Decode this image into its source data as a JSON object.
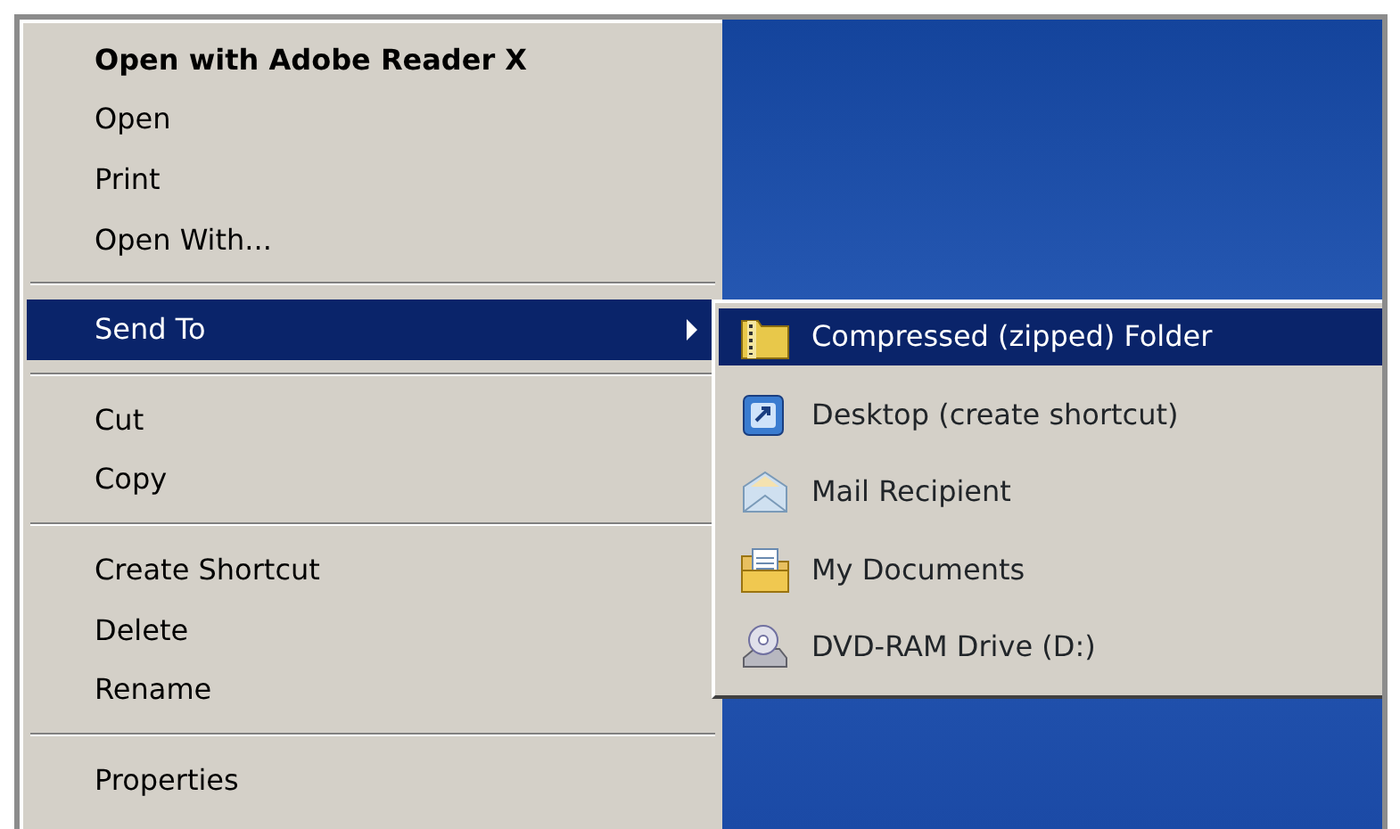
{
  "context_menu": {
    "items": [
      {
        "kind": "item",
        "label": "Open with Adobe Reader X",
        "default": true,
        "selected": false,
        "submenu": false
      },
      {
        "kind": "item",
        "label": "Open",
        "default": false,
        "selected": false,
        "submenu": false
      },
      {
        "kind": "item",
        "label": "Print",
        "default": false,
        "selected": false,
        "submenu": false
      },
      {
        "kind": "item",
        "label": "Open With...",
        "default": false,
        "selected": false,
        "submenu": false
      },
      {
        "kind": "separator"
      },
      {
        "kind": "item",
        "label": "Send To",
        "default": false,
        "selected": true,
        "submenu": true
      },
      {
        "kind": "separator"
      },
      {
        "kind": "item",
        "label": "Cut",
        "default": false,
        "selected": false,
        "submenu": false
      },
      {
        "kind": "item",
        "label": "Copy",
        "default": false,
        "selected": false,
        "submenu": false
      },
      {
        "kind": "separator"
      },
      {
        "kind": "item",
        "label": "Create Shortcut",
        "default": false,
        "selected": false,
        "submenu": false
      },
      {
        "kind": "item",
        "label": "Delete",
        "default": false,
        "selected": false,
        "submenu": false
      },
      {
        "kind": "item",
        "label": "Rename",
        "default": false,
        "selected": false,
        "submenu": false
      },
      {
        "kind": "separator"
      },
      {
        "kind": "item",
        "label": "Properties",
        "default": false,
        "selected": false,
        "submenu": false
      }
    ]
  },
  "submenu": {
    "items": [
      {
        "label": "Compressed (zipped) Folder",
        "selected": true
      },
      {
        "label": "Desktop (create shortcut)",
        "selected": false
      },
      {
        "label": "Mail Recipient",
        "selected": false
      },
      {
        "label": "My Documents",
        "selected": false
      },
      {
        "label": "DVD-RAM Drive (D:)",
        "selected": false
      }
    ]
  }
}
